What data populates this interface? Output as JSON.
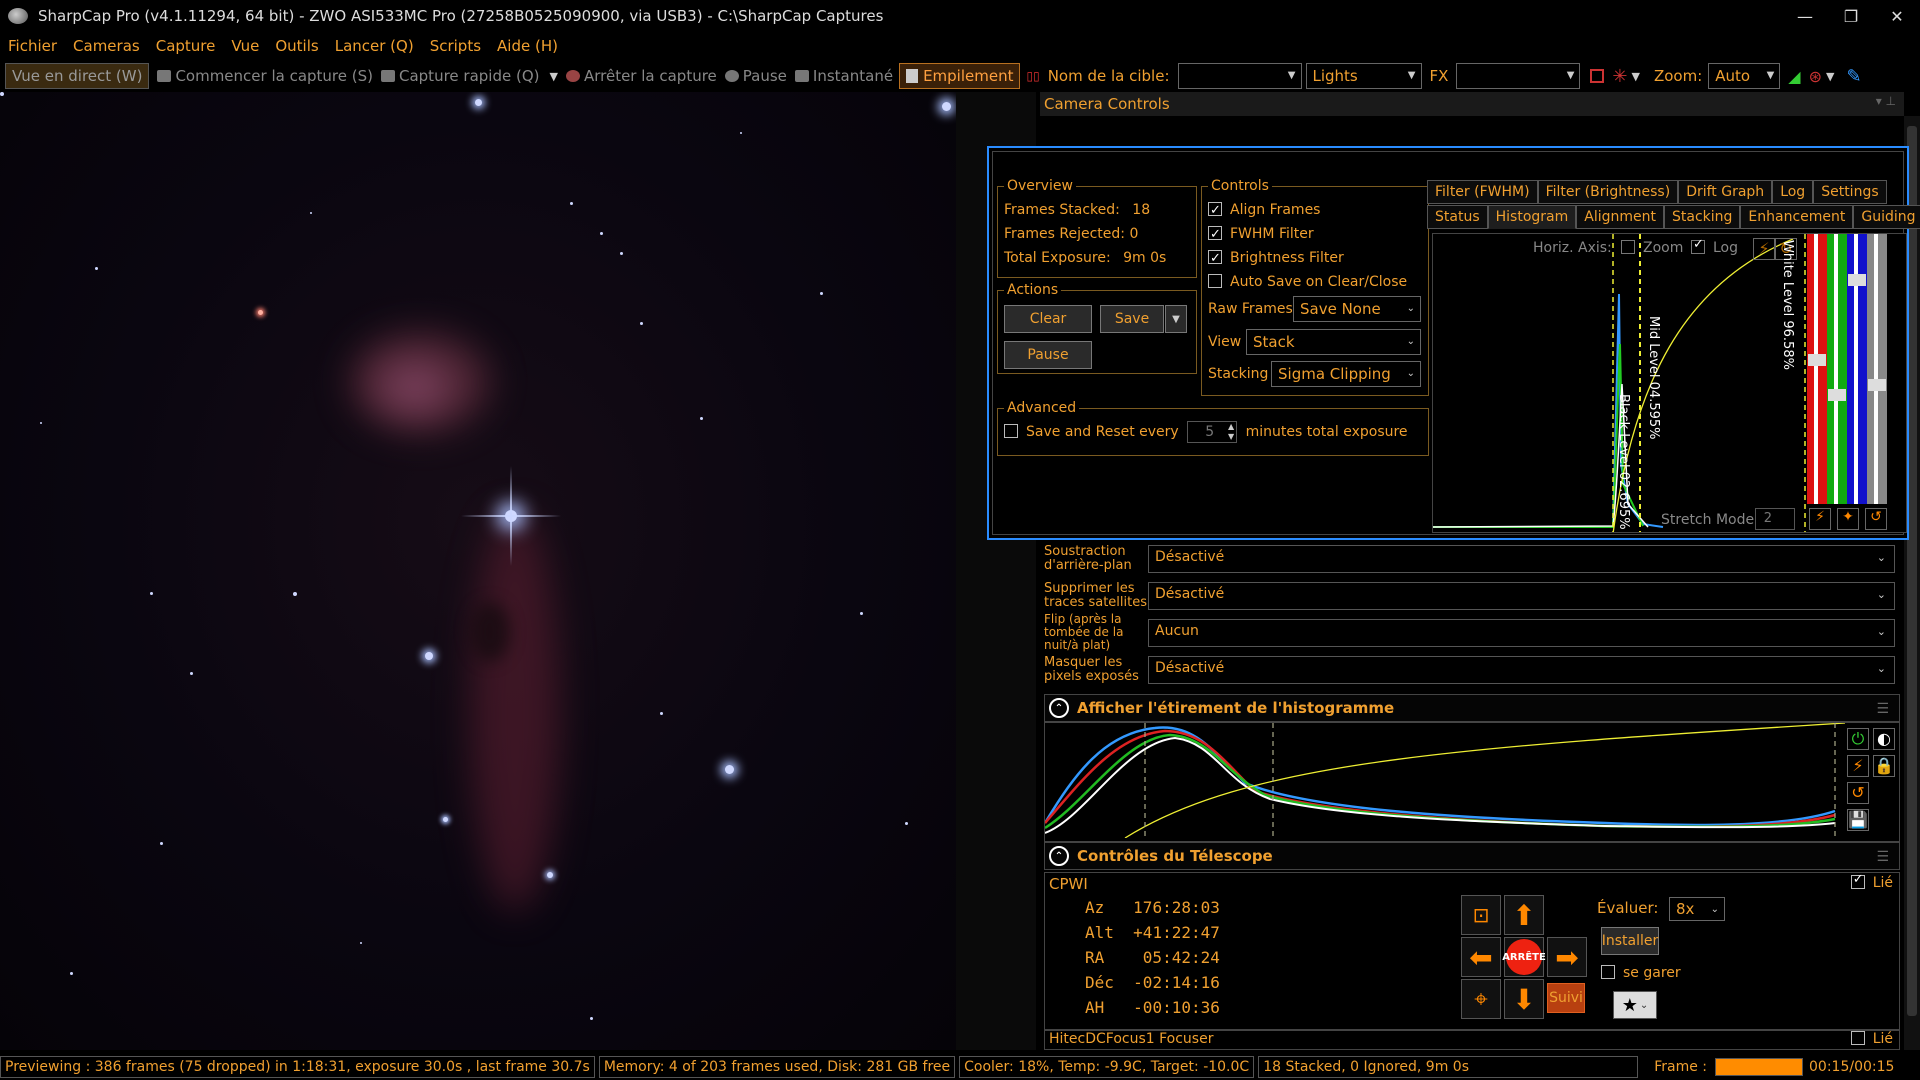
{
  "window": {
    "title": "SharpCap Pro (v4.1.11294, 64 bit) - ZWO ASI533MC Pro (27258B0525090900, via USB3) - C:\\SharpCap Captures",
    "min": "—",
    "max": "❐",
    "close": "✕"
  },
  "menu": [
    "Fichier",
    "Cameras",
    "Capture",
    "Vue",
    "Outils",
    "Lancer (Q)",
    "Scripts",
    "Aide (H)"
  ],
  "toolbar": {
    "live": "Vue en direct (W)",
    "start_capture": "Commencer la capture (S)",
    "quick_capture": "Capture rapide (Q)",
    "stop_capture": "Arrêter la capture",
    "pause": "Pause",
    "snapshot": "Instantané",
    "stacking": "Empilement",
    "target_label": "Nom de la cible:",
    "target_value": "",
    "frame_type": "Lights",
    "fx_label": "FX",
    "fx_value": "",
    "zoom_label": "Zoom:",
    "zoom_value": "Auto"
  },
  "panel": {
    "title": "Camera Controls"
  },
  "livestack": {
    "overview": {
      "legend": "Overview",
      "frames_stacked_label": "Frames Stacked:",
      "frames_stacked": "18",
      "frames_rejected_label": "Frames Rejected:",
      "frames_rejected": "0",
      "total_exposure_label": "Total Exposure:",
      "total_exposure": "9m 0s"
    },
    "actions": {
      "legend": "Actions",
      "clear": "Clear",
      "save": "Save",
      "pause": "Pause"
    },
    "controls": {
      "legend": "Controls",
      "align": "Align Frames",
      "fwhm": "FWHM Filter",
      "brightness": "Brightness Filter",
      "autosave": "Auto Save on Clear/Close",
      "raw_frames_label": "Raw Frames",
      "raw_frames": "Save None",
      "view_label": "View",
      "view": "Stack",
      "stacking_label": "Stacking",
      "stacking": "Sigma Clipping"
    },
    "advanced": {
      "legend": "Advanced",
      "save_reset": "Save and Reset every",
      "minutes": "5",
      "suffix": "minutes total exposure"
    },
    "tabs_top": [
      "Filter (FWHM)",
      "Filter (Brightness)",
      "Drift Graph",
      "Log",
      "Settings"
    ],
    "tabs_bottom": [
      "Status",
      "Histogram",
      "Alignment",
      "Stacking",
      "Enhancement",
      "Guiding"
    ],
    "histogram": {
      "horiz_axis": "Horiz. Axis:",
      "zoom": "Zoom",
      "log": "Log",
      "white_level": "White Level 96.58%",
      "mid_level": "Mid Level 04.595%",
      "black_level": "Black Level 02.695%",
      "stretch_mode": "Stretch Mode",
      "stretch_value": "2"
    }
  },
  "props": [
    {
      "label": "Soustraction d'arrière-plan",
      "value": "Désactivé"
    },
    {
      "label": "Supprimer les traces satellites",
      "value": "Désactivé"
    },
    {
      "label": "Flip (après la tombée de la nuit/à plat)",
      "value": "Aucun"
    },
    {
      "label": "Masquer les pixels exposés",
      "value": "Désactivé"
    }
  ],
  "hist_section": {
    "title": "Afficher l'étirement de l'histogramme"
  },
  "telescope": {
    "title": "Contrôles du Télescope",
    "mount": "CPWI",
    "linked": "Lié",
    "az_label": "Az",
    "az": "176:28:03",
    "alt_label": "Alt",
    "alt": "+41:22:47",
    "ra_label": "RA",
    "ra": "05:42:24",
    "dec_label": "Déc",
    "dec": "-02:14:16",
    "ah_label": "AH",
    "ah": "-00:10:36",
    "rate_label": "Évaluer:",
    "rate": "8x",
    "install": "Installer",
    "park": "se garer",
    "stop": "ARRÊTE",
    "track": "Suivi",
    "focuser": "HitecDCFocus1 Focuser",
    "focuser_linked": "Lié"
  },
  "status": {
    "preview": "Previewing : 386 frames (75 dropped) in 1:18:31, exposure 30.0s , last frame 30.7s",
    "memory": "Memory: 4 of 203 frames used, Disk: 281 GB free",
    "cooler": "Cooler: 18%, Temp: -9.9C, Target: -10.0C",
    "stacked": "18 Stacked, 0 Ignored, 9m 0s",
    "frame_label": "Frame :",
    "frame_time": "00:15/00:15",
    "frame_progress": 1.0
  }
}
